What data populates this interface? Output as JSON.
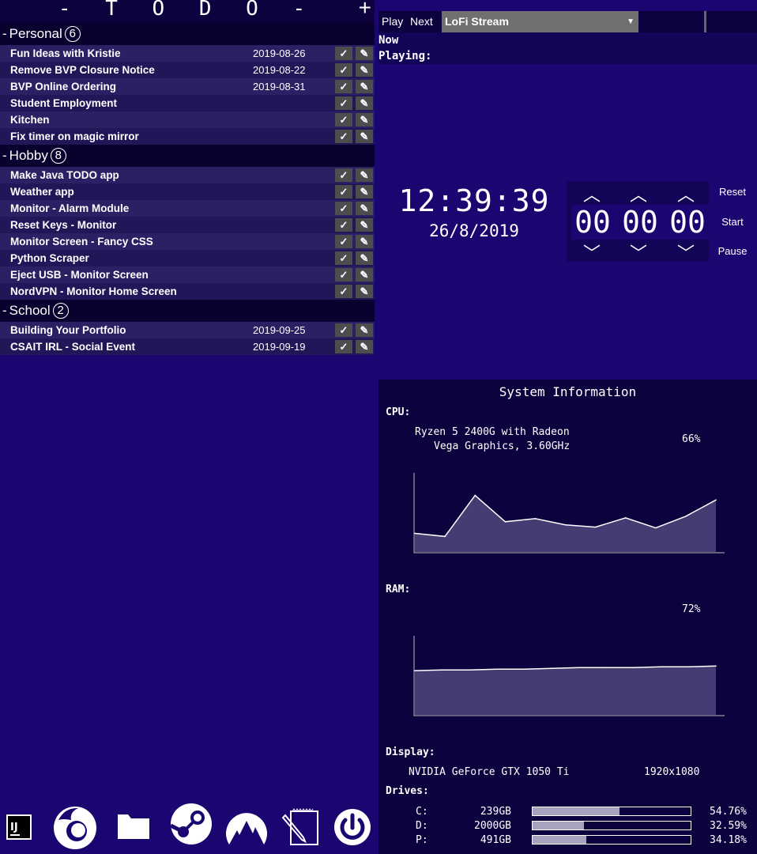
{
  "todo": {
    "title": "- T O D O -",
    "add_label": "+",
    "check_glyph": "✓",
    "edit_glyph": "✎",
    "categories": [
      {
        "name": "Personal",
        "count": "6",
        "items": [
          {
            "name": "Fun Ideas with Kristie",
            "date": "2019-08-26"
          },
          {
            "name": "Remove BVP Closure Notice",
            "date": "2019-08-22"
          },
          {
            "name": "BVP Online Ordering",
            "date": "2019-08-31"
          },
          {
            "name": "Student Employment",
            "date": ""
          },
          {
            "name": "Kitchen",
            "date": ""
          },
          {
            "name": "Fix timer on magic mirror",
            "date": ""
          }
        ]
      },
      {
        "name": "Hobby",
        "count": "8",
        "items": [
          {
            "name": "Make Java TODO app",
            "date": ""
          },
          {
            "name": "Weather app",
            "date": ""
          },
          {
            "name": "Monitor - Alarm Module",
            "date": ""
          },
          {
            "name": "Reset Keys - Monitor",
            "date": ""
          },
          {
            "name": "Monitor Screen - Fancy CSS",
            "date": ""
          },
          {
            "name": "Python Scraper",
            "date": ""
          },
          {
            "name": "Eject USB - Monitor Screen",
            "date": ""
          },
          {
            "name": "NordVPN - Monitor Home Screen",
            "date": ""
          }
        ]
      },
      {
        "name": "School",
        "count": "2",
        "items": [
          {
            "name": "Building Your Portfolio",
            "date": "2019-09-25"
          },
          {
            "name": "CSAIT IRL - Social Event",
            "date": "2019-09-19"
          }
        ]
      }
    ]
  },
  "player": {
    "play_label": "Play",
    "next_label": "Next",
    "stream_selected": "LoFi Stream",
    "now_label": "Now",
    "playing_label": "Playing:"
  },
  "clock": {
    "time": "12:39:39",
    "date": "26/8/2019"
  },
  "timer": {
    "hours": "00",
    "minutes": "00",
    "seconds": "00",
    "up_glyph": "︿",
    "down_glyph": "﹀",
    "reset_label": "Reset",
    "start_label": "Start",
    "pause_label": "Pause"
  },
  "sysinfo": {
    "title": "System Information",
    "cpu_label": "CPU:",
    "cpu_name_line1": "Ryzen 5 2400G with Radeon",
    "cpu_name_line2": "Vega Graphics, 3.60GHz",
    "cpu_percent": "66%",
    "ram_label": "RAM:",
    "ram_percent": "72%",
    "display_label": "Display:",
    "gpu_name": "NVIDIA GeForce GTX 1050 Ti",
    "resolution": "1920x1080",
    "drives_label": "Drives:",
    "drives": [
      {
        "letter": "C:",
        "size": "239GB",
        "percent": "54.76%",
        "fraction": 0.5476
      },
      {
        "letter": "D:",
        "size": "2000GB",
        "percent": "32.59%",
        "fraction": 0.3259
      },
      {
        "letter": "P:",
        "size": "491GB",
        "percent": "34.18%",
        "fraction": 0.3418
      }
    ]
  },
  "chart_data": [
    {
      "type": "area",
      "values": [
        24,
        20,
        73,
        39,
        43,
        35,
        32,
        44,
        31,
        46,
        67
      ]
    },
    {
      "type": "area",
      "values": [
        57,
        58,
        58,
        59,
        59,
        60,
        61,
        61,
        61,
        62,
        62,
        63
      ]
    }
  ],
  "dock": {
    "icons": [
      "intellij-icon",
      "firefox-icon",
      "folder-icon",
      "steam-icon",
      "nordvpn-icon",
      "notepad-icon",
      "power-icon"
    ]
  }
}
